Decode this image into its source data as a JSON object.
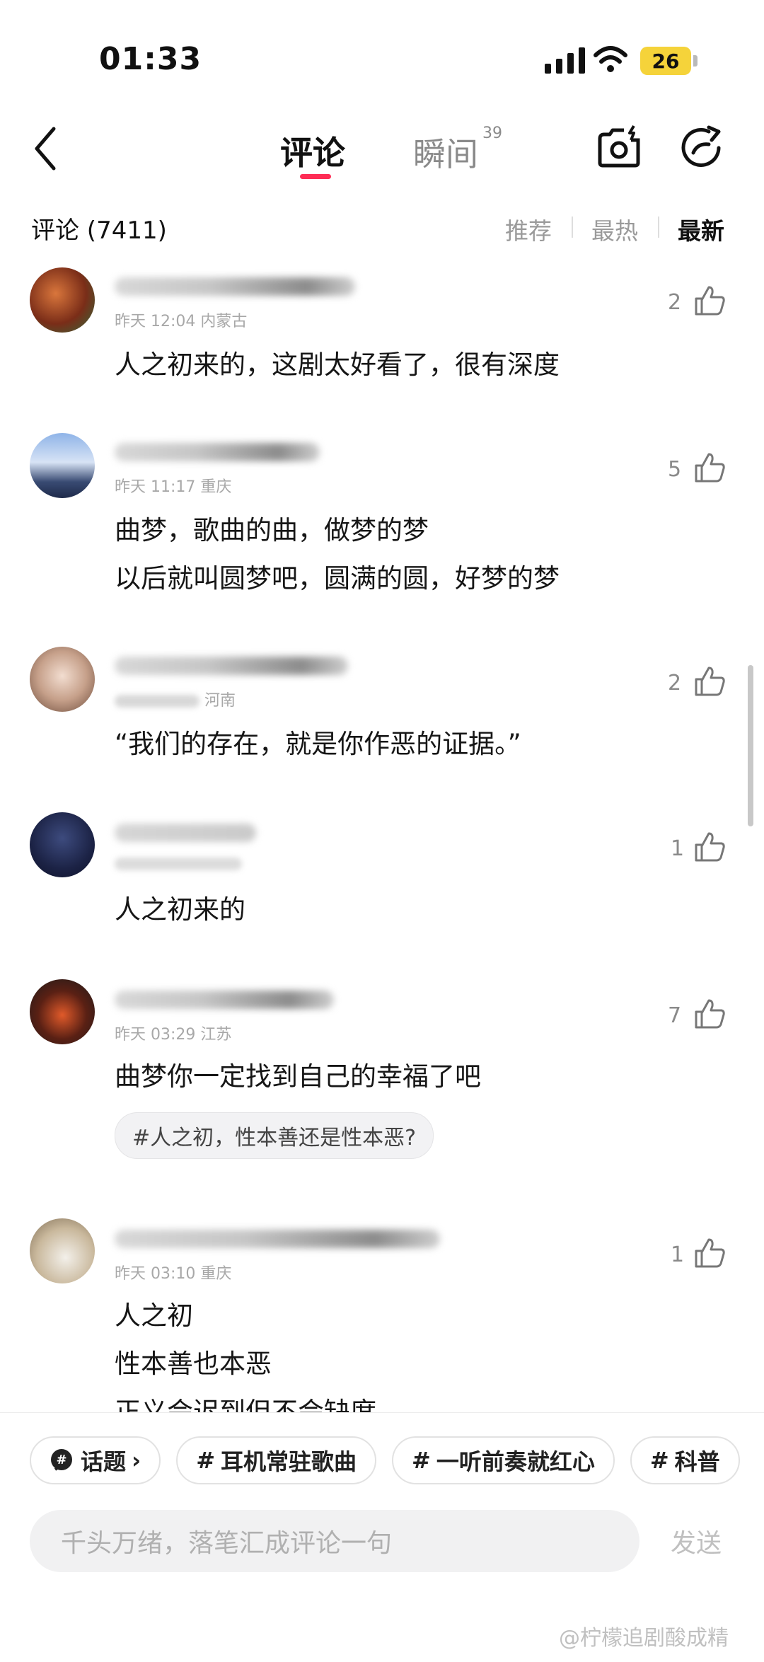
{
  "status": {
    "time": "01:33",
    "battery": "26"
  },
  "header": {
    "tab_comments": "评论",
    "tab_moments": "瞬间",
    "tab_moments_badge": "39"
  },
  "sort": {
    "count_label": "评论 (7411)",
    "options": [
      "推荐",
      "最热",
      "最新"
    ],
    "active": "最新"
  },
  "comments": [
    {
      "meta": "昨天 12:04 内蒙古",
      "lines": [
        "人之初来的，这剧太好看了，很有深度"
      ],
      "likes": "2"
    },
    {
      "meta": "昨天 11:17 重庆",
      "lines": [
        "曲梦，歌曲的曲，做梦的梦",
        "以后就叫圆梦吧，圆满的圆，好梦的梦"
      ],
      "likes": "5"
    },
    {
      "meta": "河南",
      "lines": [
        "“我们的存在，就是你作恶的证据。”"
      ],
      "likes": "2"
    },
    {
      "meta": "",
      "lines": [
        "人之初来的"
      ],
      "likes": "1"
    },
    {
      "meta": "昨天 03:29 江苏",
      "lines": [
        "曲梦你一定找到自己的幸福了吧"
      ],
      "likes": "7",
      "topic": "#人之初，性本善还是性本恶?"
    },
    {
      "meta": "昨天 03:10 重庆",
      "lines": [
        "人之初",
        "性本善也本恶",
        "正义会迟到但不会缺席"
      ],
      "likes": "1"
    }
  ],
  "topics_bar": {
    "first": "话题",
    "items": [
      "耳机常驻歌曲",
      "一听前奏就红心",
      "科普"
    ]
  },
  "composer": {
    "placeholder": "千头万绪，落笔汇成评论一句",
    "send": "发送"
  },
  "watermark": "@柠檬追剧酸成精",
  "colors": {
    "accent": "#fe2c55",
    "battery": "#f5d33a"
  }
}
